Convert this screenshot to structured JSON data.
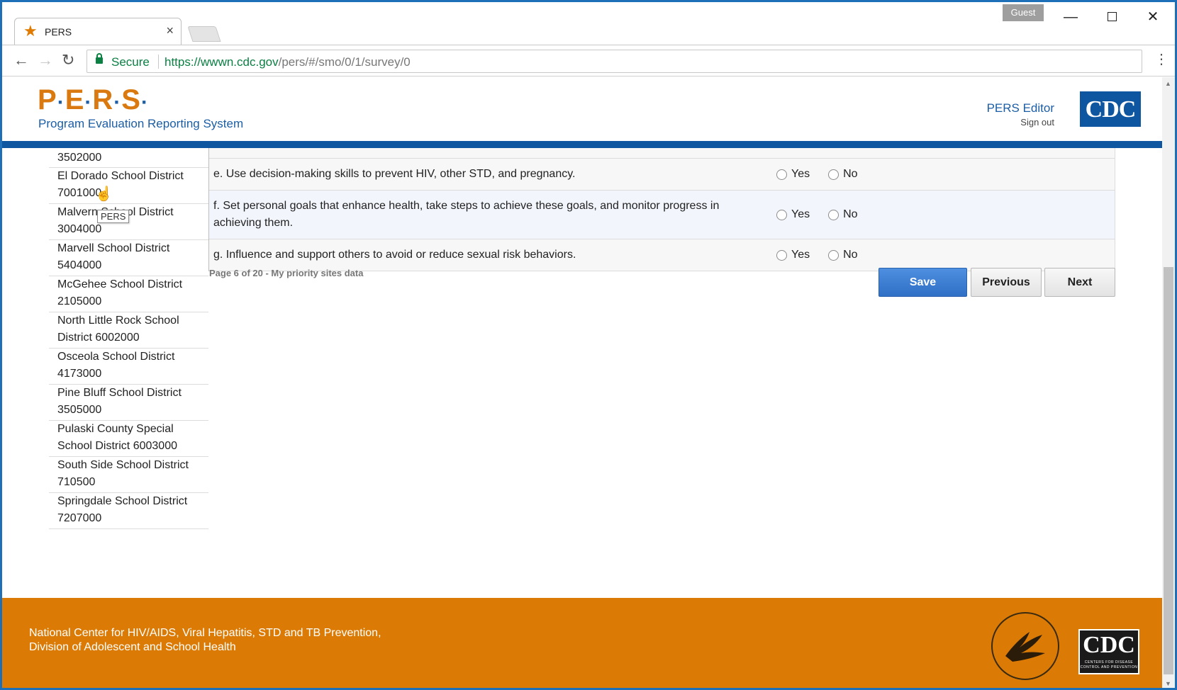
{
  "browser": {
    "tab_title": "PERS",
    "guest_label": "Guest",
    "secure_label": "Secure",
    "url_host": "https://wwwn.cdc.gov",
    "url_path": "/pers/#/smo/0/1/survey/0"
  },
  "header": {
    "logo_letters": [
      "P",
      "E",
      "R",
      "S"
    ],
    "subtitle": "Program Evaluation Reporting System",
    "editor_label": "PERS Editor",
    "signout_label": "Sign out",
    "cdc_logo_text": "CDC"
  },
  "sidebar": {
    "items": [
      {
        "line1": "3502000",
        "line2": ""
      },
      {
        "line1": "El Dorado School District",
        "line2": "7001000"
      },
      {
        "line1": "Malvern School District",
        "line2": "3004000"
      },
      {
        "line1": "Marvell School District",
        "line2": "5404000"
      },
      {
        "line1": "McGehee School District",
        "line2": "2105000"
      },
      {
        "line1": "North Little Rock School",
        "line2": "District 6002000"
      },
      {
        "line1": "Osceola School District",
        "line2": "4173000"
      },
      {
        "line1": "Pine Bluff School District",
        "line2": "3505000"
      },
      {
        "line1": "Pulaski County Special",
        "line2": "School District 6003000"
      },
      {
        "line1": "South Side School District",
        "line2": "710500"
      },
      {
        "line1": "Springdale School District",
        "line2": "7207000"
      }
    ],
    "tooltip": "PERS"
  },
  "survey": {
    "questions": [
      {
        "text": "e. Use decision-making skills to prevent HIV, other STD, and pregnancy.",
        "yes": "Yes",
        "no": "No"
      },
      {
        "text": "f. Set personal goals that enhance health, take steps to achieve these goals, and monitor progress in achieving them.",
        "yes": "Yes",
        "no": "No"
      },
      {
        "text": "g. Influence and support others to avoid or reduce sexual risk behaviors.",
        "yes": "Yes",
        "no": "No"
      }
    ],
    "pager_text": "Page 6 of 20 - My priority sites data",
    "save_label": "Save",
    "previous_label": "Previous",
    "next_label": "Next"
  },
  "footer": {
    "line1": "National Center for HIV/AIDS, Viral Hepatitis, STD and TB Prevention,",
    "line2": "Division of Adolescent and School Health",
    "cdc_text": "CDC",
    "cdc_small": "CENTERS FOR DISEASE CONTROL AND PREVENTION"
  },
  "colors": {
    "brand_orange": "#db7b06",
    "brand_blue": "#0e56a0",
    "secure_green": "#0b8043"
  }
}
